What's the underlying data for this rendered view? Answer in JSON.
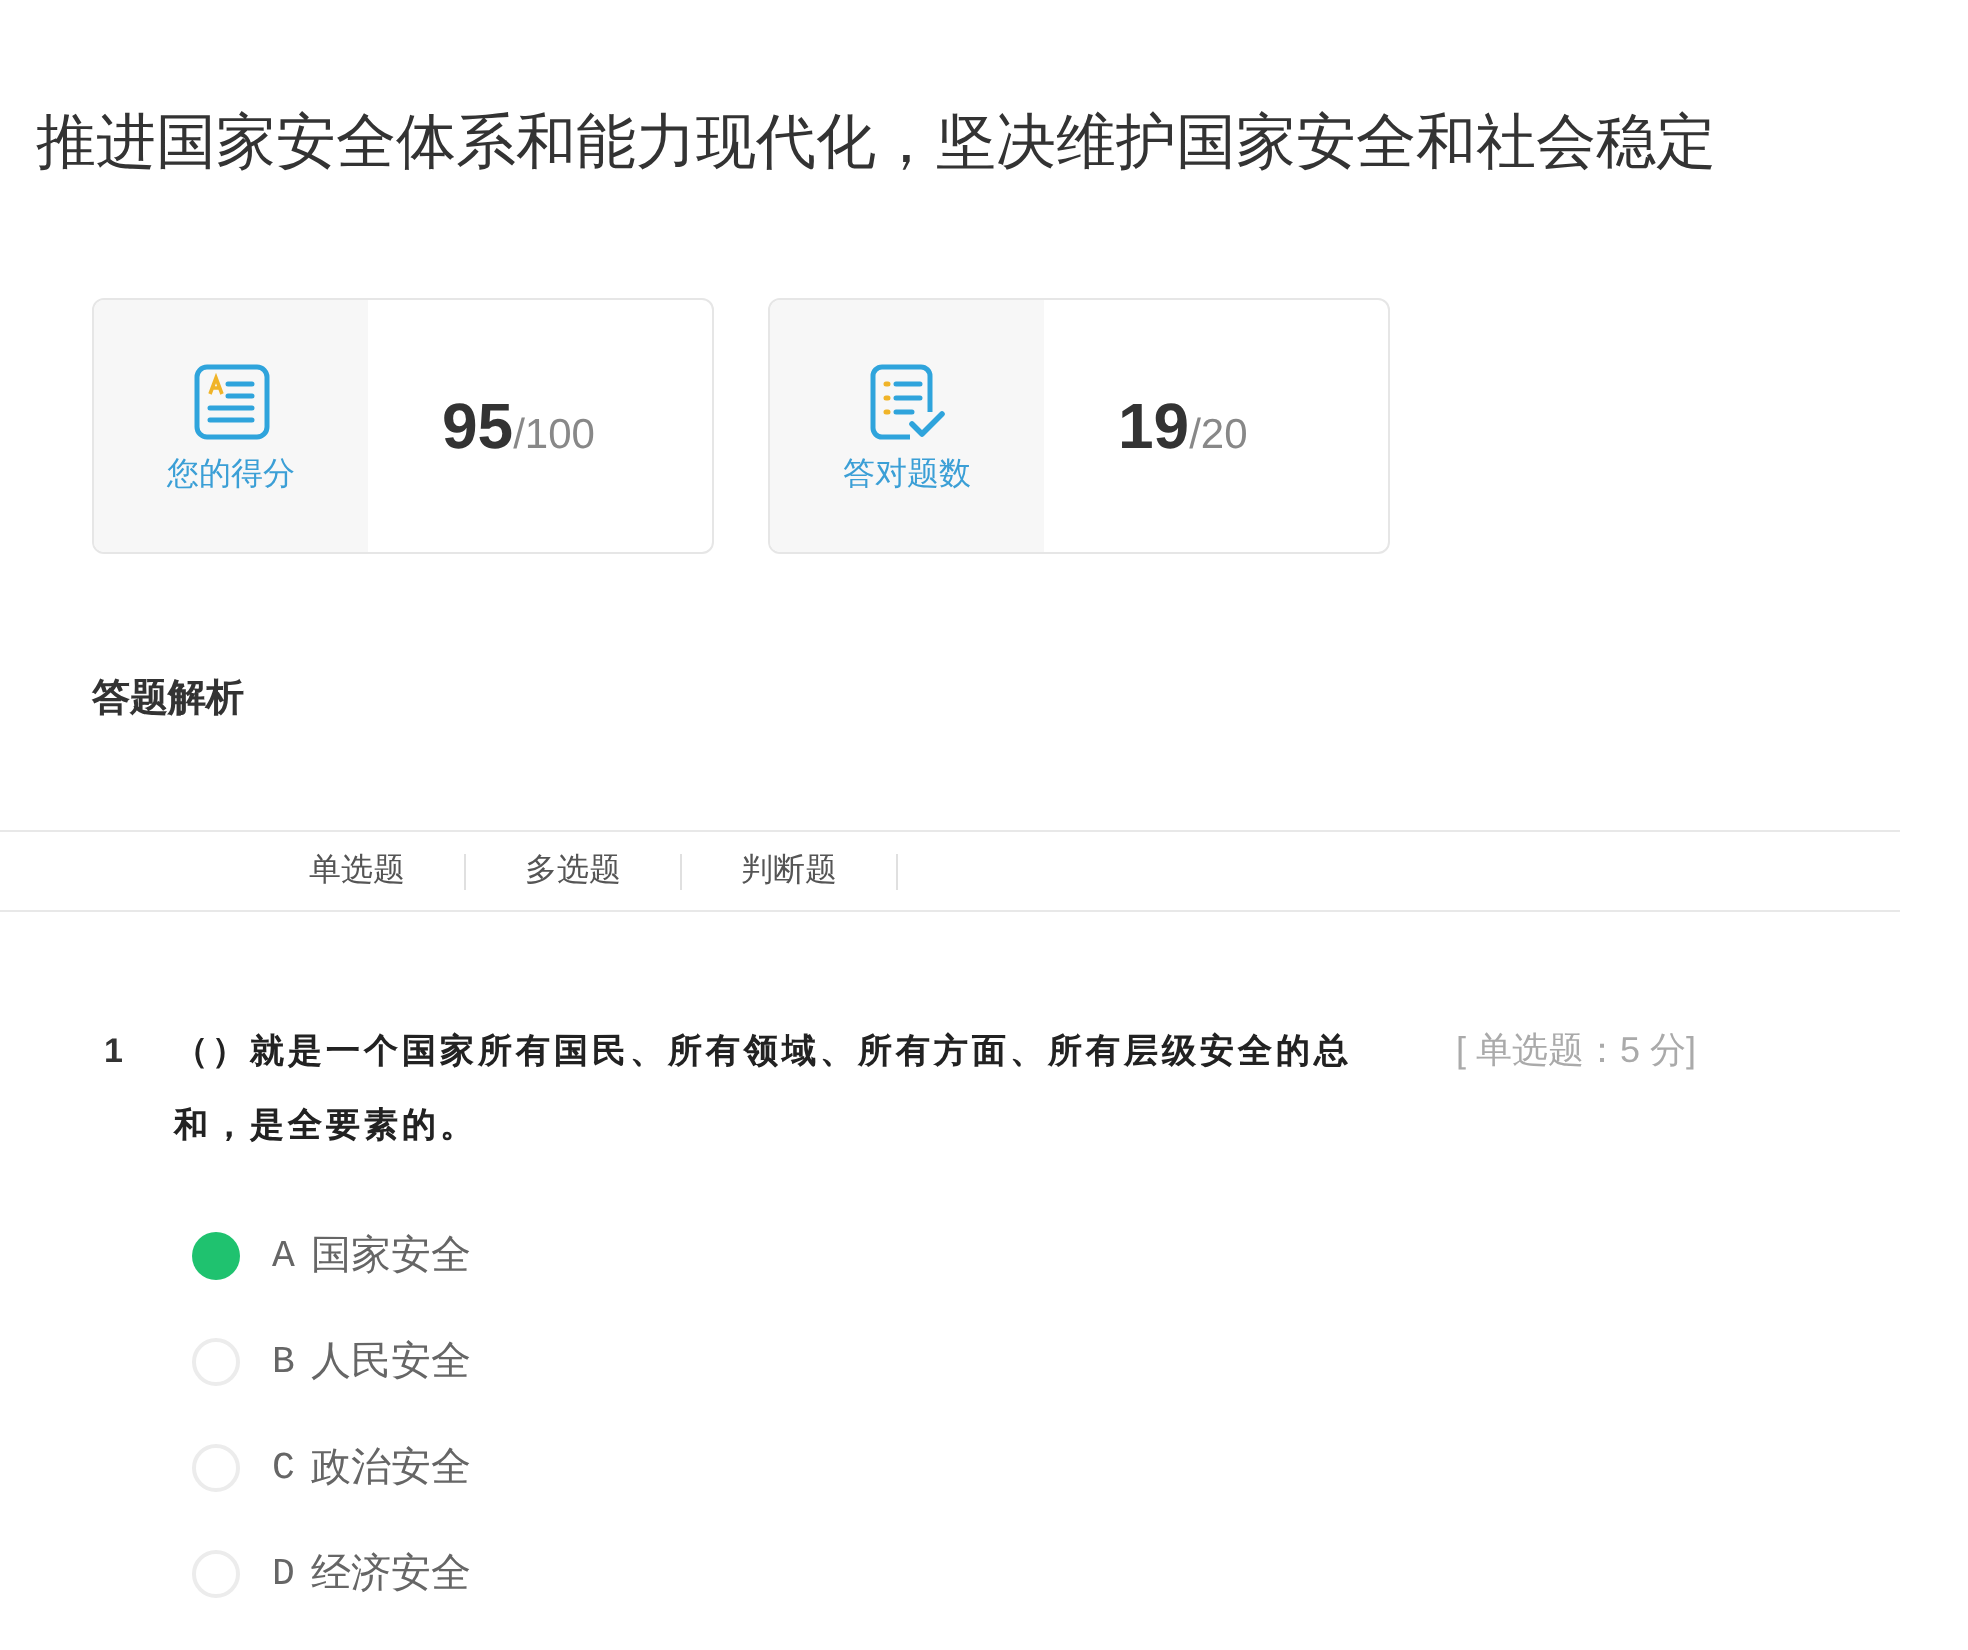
{
  "page": {
    "title": "推进国家安全体系和能力现代化，坚决维护国家安全和社会稳定"
  },
  "stats": [
    {
      "kind": "score",
      "label": "您的得分",
      "value": "95",
      "total": "/100"
    },
    {
      "kind": "correct",
      "label": "答对题数",
      "value": "19",
      "total": "/20"
    }
  ],
  "section": {
    "title": "答题解析"
  },
  "tabs": [
    {
      "label": "单选题",
      "selected": false
    },
    {
      "label": "多选题",
      "selected": false
    },
    {
      "label": "判断题",
      "selected": false
    }
  ],
  "question": {
    "number": "1",
    "text": "（）就是一个国家所有国民、所有领域、所有方面、所有层级安全的总和，是全要素的。",
    "tag": "[ 单选题：5 分]",
    "options": [
      {
        "letter": "A",
        "text": "国家安全",
        "selected": true
      },
      {
        "letter": "B",
        "text": "人民安全",
        "selected": false
      },
      {
        "letter": "C",
        "text": "政治安全",
        "selected": false
      },
      {
        "letter": "D",
        "text": "经济安全",
        "selected": false
      }
    ]
  }
}
